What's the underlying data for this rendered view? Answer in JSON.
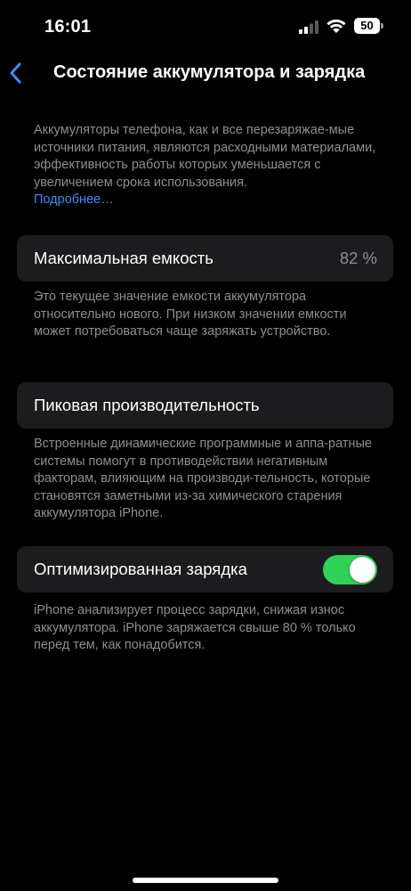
{
  "status_bar": {
    "time": "16:01",
    "battery_level": "50"
  },
  "nav": {
    "title": "Состояние аккумулятора и зарядка"
  },
  "intro": {
    "text": "Аккумуляторы телефона, как и все перезаряжае-мые источники питания, являются расходными материалами, эффективность работы которых уменьшается с увеличением срока использования.",
    "link": "Подробнее…"
  },
  "max_capacity": {
    "label": "Максимальная емкость",
    "value": "82 %",
    "footnote": "Это текущее значение емкости аккумулятора относительно нового. При низком значении емкости может потребоваться чаще заряжать устройство."
  },
  "peak_performance": {
    "label": "Пиковая производительность",
    "footnote": "Встроенные динамические программные и аппа-ратные системы помогут в противодействии негативным факторам, влияющим на производи-тельность, которые становятся заметными из-за химического старения аккумулятора iPhone."
  },
  "optimized_charging": {
    "label": "Оптимизированная зарядка",
    "enabled": true,
    "footnote": "iPhone анализирует процесс зарядки, снижая износ аккумулятора. iPhone заряжается свыше 80 % только перед тем, как понадобится."
  },
  "colors": {
    "background": "#000000",
    "cell": "#1c1c1e",
    "secondary_text": "#8e8e93",
    "link": "#3a8ff7",
    "toggle_on": "#30d158"
  },
  "icons": {
    "back": "chevron-left-icon",
    "signal": "cellular-signal-icon",
    "wifi": "wifi-icon",
    "battery": "battery-icon"
  }
}
